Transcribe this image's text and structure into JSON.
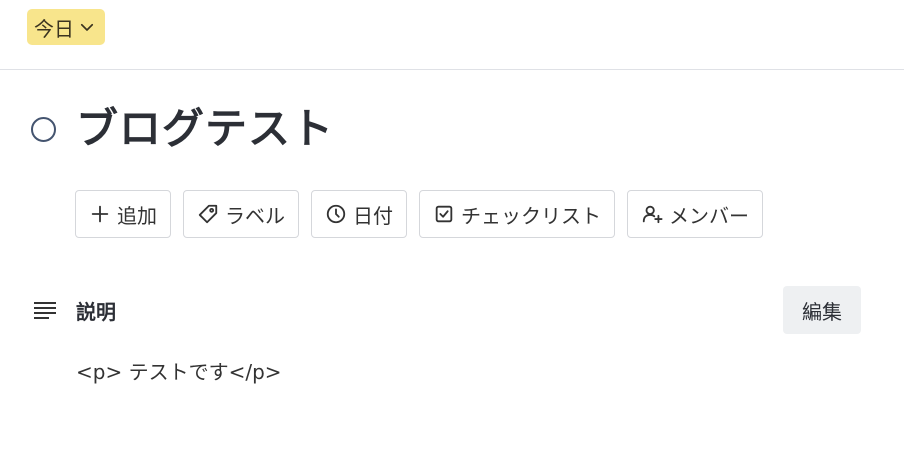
{
  "header": {
    "list_name": "今日"
  },
  "card": {
    "title": "ブログテスト"
  },
  "actions": {
    "add": "追加",
    "label": "ラベル",
    "date": "日付",
    "checklist": "チェックリスト",
    "members": "メンバー"
  },
  "description": {
    "heading": "説明",
    "edit_label": "編集",
    "content": "<p> テストです</p>"
  },
  "icons": {
    "chevron": "chevron-down-icon",
    "add": "plus-icon",
    "label": "tag-icon",
    "date": "clock-icon",
    "checklist": "checkbox-icon",
    "members": "add-person-icon",
    "description": "text-lines-icon"
  },
  "colors": {
    "list_badge_bg": "#f8e58c",
    "edit_button_bg": "#eef0f2"
  }
}
